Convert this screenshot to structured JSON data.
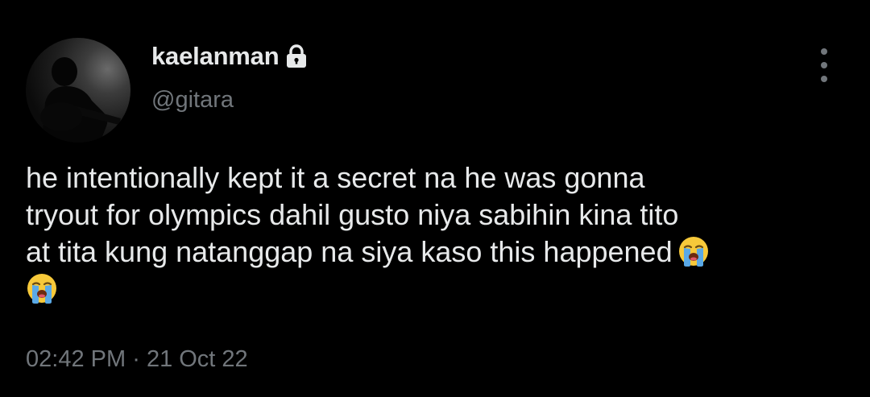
{
  "user": {
    "display_name": "kaelanman",
    "handle": "@gitara",
    "protected_icon": "lock-icon",
    "avatar_icon": "avatar"
  },
  "menu": {
    "icon": "more-vertical-icon"
  },
  "tweet": {
    "lines": [
      "he intentionally kept it a secret na he was gonna",
      "tryout for olympics dahil gusto niya sabihin kina tito",
      "at tita kung natanggap na siya kaso this happened"
    ],
    "emoji": "loudly-crying-face-emoji",
    "time": "02:42 PM",
    "separator": "·",
    "date": "21 Oct 22"
  },
  "colors": {
    "background": "#000000",
    "primary_text": "#e7e9ea",
    "secondary_text": "#71767b"
  }
}
